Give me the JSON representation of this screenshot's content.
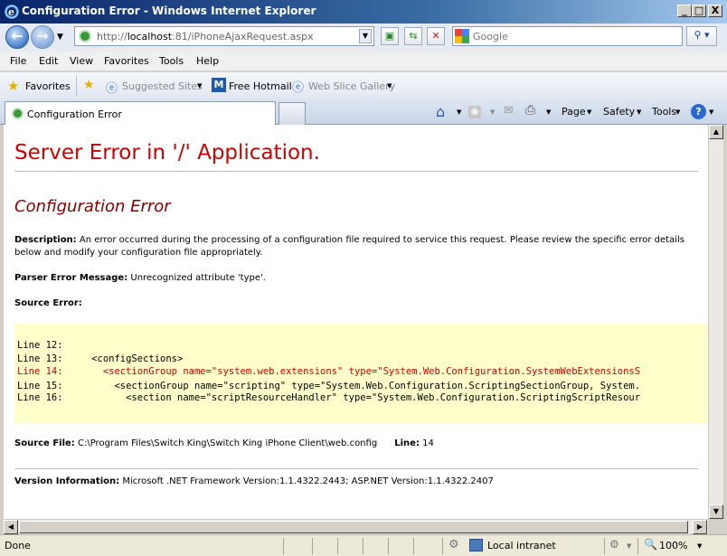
{
  "window": {
    "title": "Configuration Error - Windows Internet Explorer",
    "controls": [
      "_",
      "□",
      "X"
    ]
  },
  "nav": {
    "address_prefix": "http://",
    "address_host": "localhost",
    "address_rest": ":81/iPhoneAjaxRequest.aspx",
    "search_placeholder": "Google"
  },
  "menu": [
    "File",
    "Edit",
    "View",
    "Favorites",
    "Tools",
    "Help"
  ],
  "favorites": {
    "label": "Favorites",
    "items": [
      "Suggested Sites",
      "Free Hotmail",
      "Web Slice Gallery"
    ]
  },
  "tab": {
    "label": "Configuration Error"
  },
  "commands": [
    "Page",
    "Safety",
    "Tools"
  ],
  "page": {
    "title": "Server Error in '/' Application.",
    "subtitle": "Configuration Error",
    "description_label": "Description:",
    "description": "An error occurred during the processing of a configuration file required to service this request. Please review the specific error details",
    "description_line2": "below and modify your configuration file appropriately.",
    "parser_label": "Parser Error Message:",
    "parser_message": "Unrecognized attribute 'type'.",
    "source_error_label": "Source Error:",
    "code_lines": [
      "Line 12:",
      "Line 13:     <configSections>",
      "Line 14:       <sectionGroup name=\"system.web.extensions\" type=\"System.Web.Configuration.SystemWebExtensionsS",
      "Line 15:         <sectionGroup name=\"scripting\" type=\"System.Web.Configuration.ScriptingSectionGroup, System.",
      "Line 16:           <section name=\"scriptResourceHandler\" type=\"System.Web.Configuration.ScriptingScriptResour"
    ],
    "error_line_index": 2,
    "source_file_label": "Source File:",
    "source_file": "C:\\Program Files\\Switch King\\Switch King iPhone Client\\web.config",
    "line_label": "Line:",
    "line_value": "14",
    "version_label": "Version Information:",
    "version": "Microsoft .NET Framework Version:1.1.4322.2443; ASP.NET Version:1.1.4322.2407"
  },
  "status": {
    "text": "Done",
    "zone": "Local intranet",
    "zoom": "100%"
  }
}
